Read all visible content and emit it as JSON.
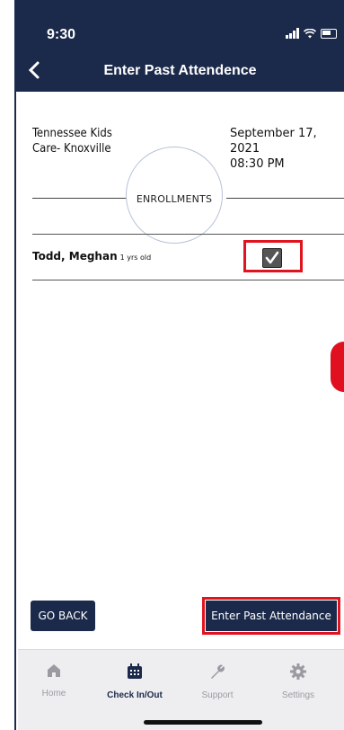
{
  "status": {
    "time": "9:30"
  },
  "header": {
    "title": "Enter Past Attendence"
  },
  "center": {
    "name": "Tennessee Kids\nCare- Knoxville",
    "date": "September 17, 2021\n08:30 PM"
  },
  "enrollments_label": "ENROLLMENTS",
  "children": [
    {
      "name": "Todd, Meghan",
      "age": "1 yrs old",
      "checked": true
    }
  ],
  "buttons": {
    "go_back": "GO BACK",
    "enter": "Enter Past Attendance"
  },
  "tabs": [
    {
      "label": "Home",
      "icon": "home-icon",
      "active": false
    },
    {
      "label": "Check In/Out",
      "icon": "calendar-icon",
      "active": true
    },
    {
      "label": "Support",
      "icon": "wrench-icon",
      "active": false
    },
    {
      "label": "Settings",
      "icon": "gear-icon",
      "active": false
    }
  ],
  "colors": {
    "navy": "#1b2a4a",
    "highlight": "#e0141e"
  }
}
